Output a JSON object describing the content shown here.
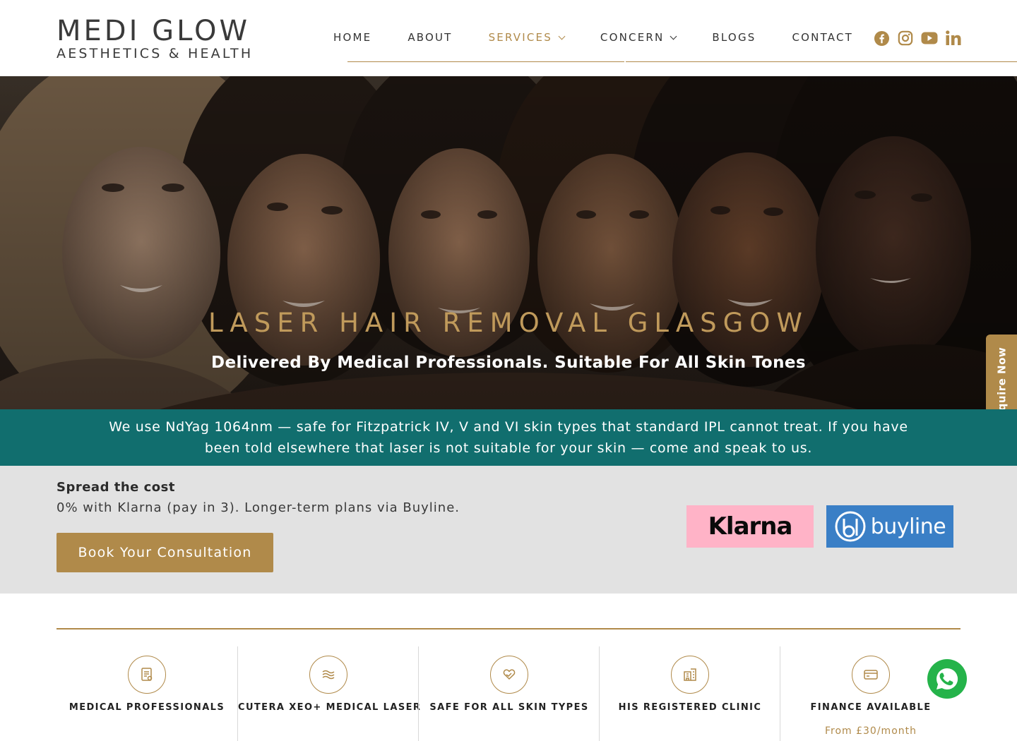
{
  "header": {
    "logo_main": "MEDI GLOW",
    "logo_sub": "AESTHETICS & HEALTH",
    "nav": [
      {
        "label": "HOME"
      },
      {
        "label": "ABOUT"
      },
      {
        "label": "SERVICES",
        "active": true
      },
      {
        "label": "CONCERN"
      },
      {
        "label": "BLOGS"
      },
      {
        "label": "CONTACT"
      }
    ],
    "socials": [
      "facebook-icon",
      "instagram-icon",
      "youtube-icon",
      "linkedin-icon"
    ]
  },
  "hero": {
    "title": "LASER HAIR REMOVAL GLASGOW",
    "subtitle": "Delivered By Medical Professionals. Suitable For All Skin Tones"
  },
  "enquire": {
    "label": "Enquire Now"
  },
  "banner": {
    "line1": "We use NdYag 1064nm — safe for Fitzpatrick IV, V and VI skin types that standard IPL cannot treat. If you have",
    "line2": "been told elsewhere that laser is not suitable for your skin — come and speak to us."
  },
  "finance": {
    "title": "Spread the cost",
    "text": "0% with Klarna (pay in 3). Longer-term plans via Buyline.",
    "button": "Book Your Consultation",
    "klarna": "Klarna",
    "buyline": "buyline"
  },
  "features": [
    {
      "label": "MEDICAL PROFESSIONALS",
      "icon": "certificate-icon"
    },
    {
      "label": "CUTERA XEO+ MEDICAL LASER",
      "icon": "laser-waves-icon"
    },
    {
      "label": "SAFE FOR ALL SKIN TYPES",
      "icon": "heart-hands-icon"
    },
    {
      "label": "HIS REGISTERED CLINIC",
      "icon": "clinic-building-icon"
    },
    {
      "label": "FINANCE AVAILABLE",
      "icon": "credit-card-icon",
      "note": "From £30/month"
    }
  ],
  "colors": {
    "gold": "#b08a4a",
    "teal": "#116e6e",
    "grey": "#e2e2e2",
    "whatsapp": "#25b34a"
  }
}
